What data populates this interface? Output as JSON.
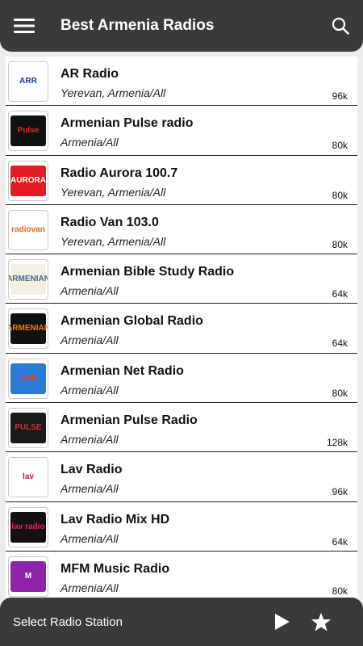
{
  "app_bar": {
    "title": "Best Armenia Radios",
    "menu_icon": "hamburger-menu-icon",
    "search_icon": "search-icon",
    "background": "#3a3a3a"
  },
  "stations": [
    {
      "name": "AR Radio",
      "location": "Yerevan, Armenia/All",
      "bitrate": "96k",
      "logo_text": "ARR",
      "logo_bg": "#ffffff",
      "logo_fg": "#1e3a8a"
    },
    {
      "name": "Armenian Pulse radio",
      "location": "Armenia/All",
      "bitrate": "80k",
      "logo_text": "Pulse",
      "logo_bg": "#111111",
      "logo_fg": "#e02424"
    },
    {
      "name": "Radio Aurora 100.7",
      "location": "Yerevan, Armenia/All",
      "bitrate": "80k",
      "logo_text": "AURORA",
      "logo_bg": "#e31b23",
      "logo_fg": "#ffffff"
    },
    {
      "name": "Radio Van 103.0",
      "location": "Yerevan, Armenia/All",
      "bitrate": "80k",
      "logo_text": "radiovan",
      "logo_bg": "#ffffff",
      "logo_fg": "#e8641b"
    },
    {
      "name": "Armenian Bible Study Radio",
      "location": "Armenia/All",
      "bitrate": "64k",
      "logo_text": "ARMENIAN",
      "logo_bg": "#f3efe2",
      "logo_fg": "#3c6e8f"
    },
    {
      "name": "Armenian Global Radio",
      "location": "Armenia/All",
      "bitrate": "64k",
      "logo_text": "ARMENIAN",
      "logo_bg": "#111111",
      "logo_fg": "#ff7a00"
    },
    {
      "name": "Armenian Net Radio",
      "location": "Armenia/All",
      "bitrate": "80k",
      "logo_text": "ANR",
      "logo_bg": "#2a7ad6",
      "logo_fg": "#e0413a"
    },
    {
      "name": "Armenian Pulse Radio",
      "location": "Armenia/All",
      "bitrate": "128k",
      "logo_text": "PULSE",
      "logo_bg": "#1a1a1a",
      "logo_fg": "#d32f2f"
    },
    {
      "name": "Lav Radio",
      "location": "Armenia/All",
      "bitrate": "96k",
      "logo_text": "lav",
      "logo_bg": "#ffffff",
      "logo_fg": "#c2185b"
    },
    {
      "name": "Lav Radio Mix HD",
      "location": "Armenia/All",
      "bitrate": "64k",
      "logo_text": "lav radio",
      "logo_bg": "#111111",
      "logo_fg": "#e91e63"
    },
    {
      "name": "MFM Music Radio",
      "location": "Armenia/All",
      "bitrate": "80k",
      "logo_text": "M",
      "logo_bg": "#8e24aa",
      "logo_fg": "#ffffff"
    }
  ],
  "player": {
    "label": "Select Radio Station",
    "play_icon": "play-icon",
    "favorite_icon": "star-icon"
  }
}
